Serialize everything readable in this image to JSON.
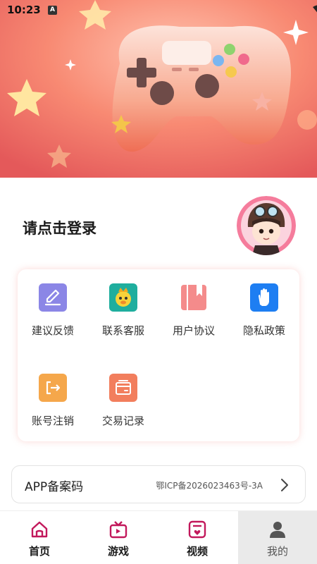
{
  "status_bar": {
    "time": "10:23",
    "notification_badge": "A",
    "icons": [
      "wifi-icon",
      "signal-icon",
      "battery-charging-icon"
    ]
  },
  "hero": {
    "image": "game-controller-banner"
  },
  "profile": {
    "login_prompt": "请点击登录",
    "avatar": "aviator-character-avatar"
  },
  "menu": {
    "items": [
      {
        "label": "建议反馈",
        "icon": "feedback-pencil-icon",
        "color": "#8b86e6"
      },
      {
        "label": "联系客服",
        "icon": "customer-service-icon",
        "color": "#1fae9e"
      },
      {
        "label": "用户协议",
        "icon": "user-agreement-book-icon",
        "color": "#f48b8b"
      },
      {
        "label": "隐私政策",
        "icon": "privacy-hand-icon",
        "color": "#1e7ef2"
      },
      {
        "label": "账号注销",
        "icon": "account-logout-icon",
        "color": "#f5a74b"
      },
      {
        "label": "交易记录",
        "icon": "transaction-record-icon",
        "color": "#f27e5d"
      }
    ]
  },
  "icp": {
    "title": "APP备案码",
    "value": "鄂ICP备2026023463号-3A"
  },
  "tabbar": {
    "accent": "#c2185b",
    "tabs": [
      {
        "label": "首页",
        "icon": "home-icon",
        "active": false
      },
      {
        "label": "游戏",
        "icon": "game-icon",
        "active": false
      },
      {
        "label": "视频",
        "icon": "video-icon",
        "active": false
      },
      {
        "label": "我的",
        "icon": "profile-icon",
        "active": true
      }
    ]
  }
}
